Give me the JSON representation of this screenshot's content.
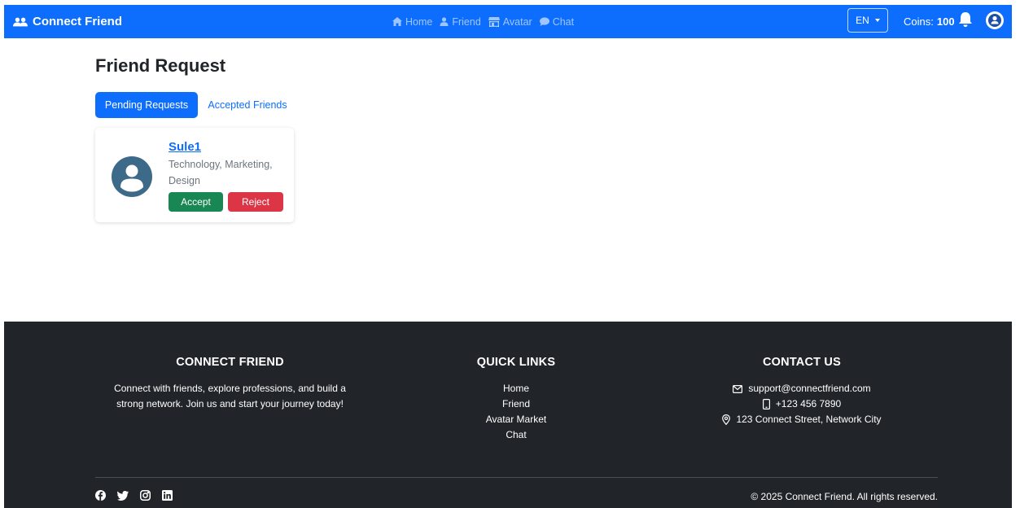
{
  "navbar": {
    "brand": "Connect Friend",
    "links": [
      {
        "label": "Home",
        "icon": "home-icon"
      },
      {
        "label": "Friend",
        "icon": "person-icon"
      },
      {
        "label": "Avatar",
        "icon": "store-icon"
      },
      {
        "label": "Chat",
        "icon": "chat-icon"
      }
    ],
    "language": "EN",
    "coins_label": "Coins:",
    "coins_value": "100"
  },
  "main": {
    "title": "Friend Request",
    "tabs": [
      {
        "label": "Pending Requests",
        "active": true
      },
      {
        "label": "Accepted Friends",
        "active": false
      }
    ],
    "requests": [
      {
        "name": "Sule1",
        "interests": "Technology, Marketing, Design",
        "accept_label": "Accept",
        "reject_label": "Reject"
      }
    ]
  },
  "footer": {
    "about": {
      "heading": "CONNECT FRIEND",
      "text": "Connect with friends, explore professions, and build a strong network. Join us and start your journey today!"
    },
    "quick_links": {
      "heading": "QUICK LINKS",
      "items": [
        "Home",
        "Friend",
        "Avatar Market",
        "Chat"
      ]
    },
    "contact": {
      "heading": "CONTACT US",
      "email": "support@connectfriend.com",
      "phone": "+123 456 7890",
      "address": "123 Connect Street, Network City"
    },
    "socials": [
      "facebook-icon",
      "twitter-icon",
      "instagram-icon",
      "linkedin-icon"
    ],
    "copyright": "© 2025 Connect Friend. All rights reserved."
  },
  "colors": {
    "primary": "#0d6efd",
    "success": "#198754",
    "danger": "#dc3545",
    "footer_bg": "#212529",
    "avatar_bg": "#3e6a8a"
  }
}
